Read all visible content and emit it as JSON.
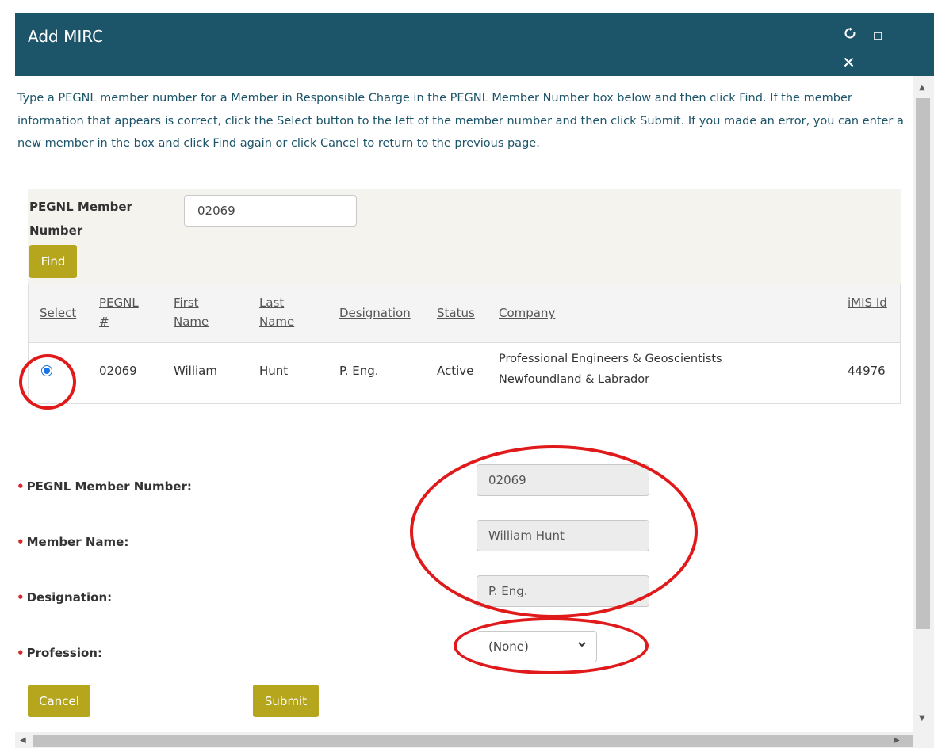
{
  "dialog": {
    "title": "Add MIRC",
    "instructions": "Type a PEGNL member number for a Member in Responsible Charge in the PEGNL Member Number box below and then click Find. If the member information that appears is correct, click the Select button to the left of the member number and then click Submit. If you made an error, you can enter a new member in the box and click Find again or click Cancel to return to the previous page."
  },
  "search": {
    "label": "PEGNL Member Number",
    "value": "02069",
    "find_label": "Find"
  },
  "results": {
    "columns": [
      "Select",
      "PEGNL #",
      "First Name",
      "Last Name",
      "Designation",
      "Status",
      "Company",
      "iMIS Id"
    ],
    "rows": [
      {
        "pegnl": "02069",
        "first": "William",
        "last": "Hunt",
        "designation": "P. Eng.",
        "status": "Active",
        "company": "Professional Engineers & Geoscientists Newfoundland & Labrador",
        "imis": "44976",
        "selected": true
      }
    ]
  },
  "form": {
    "member_number_label": "PEGNL Member Number:",
    "member_number_value": "02069",
    "member_name_label": "Member Name:",
    "member_name_value": "William Hunt",
    "designation_label": "Designation:",
    "designation_value": "P. Eng.",
    "profession_label": "Profession:",
    "profession_value": "(None)",
    "required_marker": "•",
    "cancel_label": "Cancel",
    "submit_label": "Submit"
  },
  "colors": {
    "titlebar": "#1c5469",
    "button": "#b5a61e",
    "annotation": "#e0191a",
    "required": "#d9262a"
  },
  "icons": {
    "refresh": "refresh-icon",
    "maximize": "maximize-icon",
    "close": "close-icon"
  }
}
